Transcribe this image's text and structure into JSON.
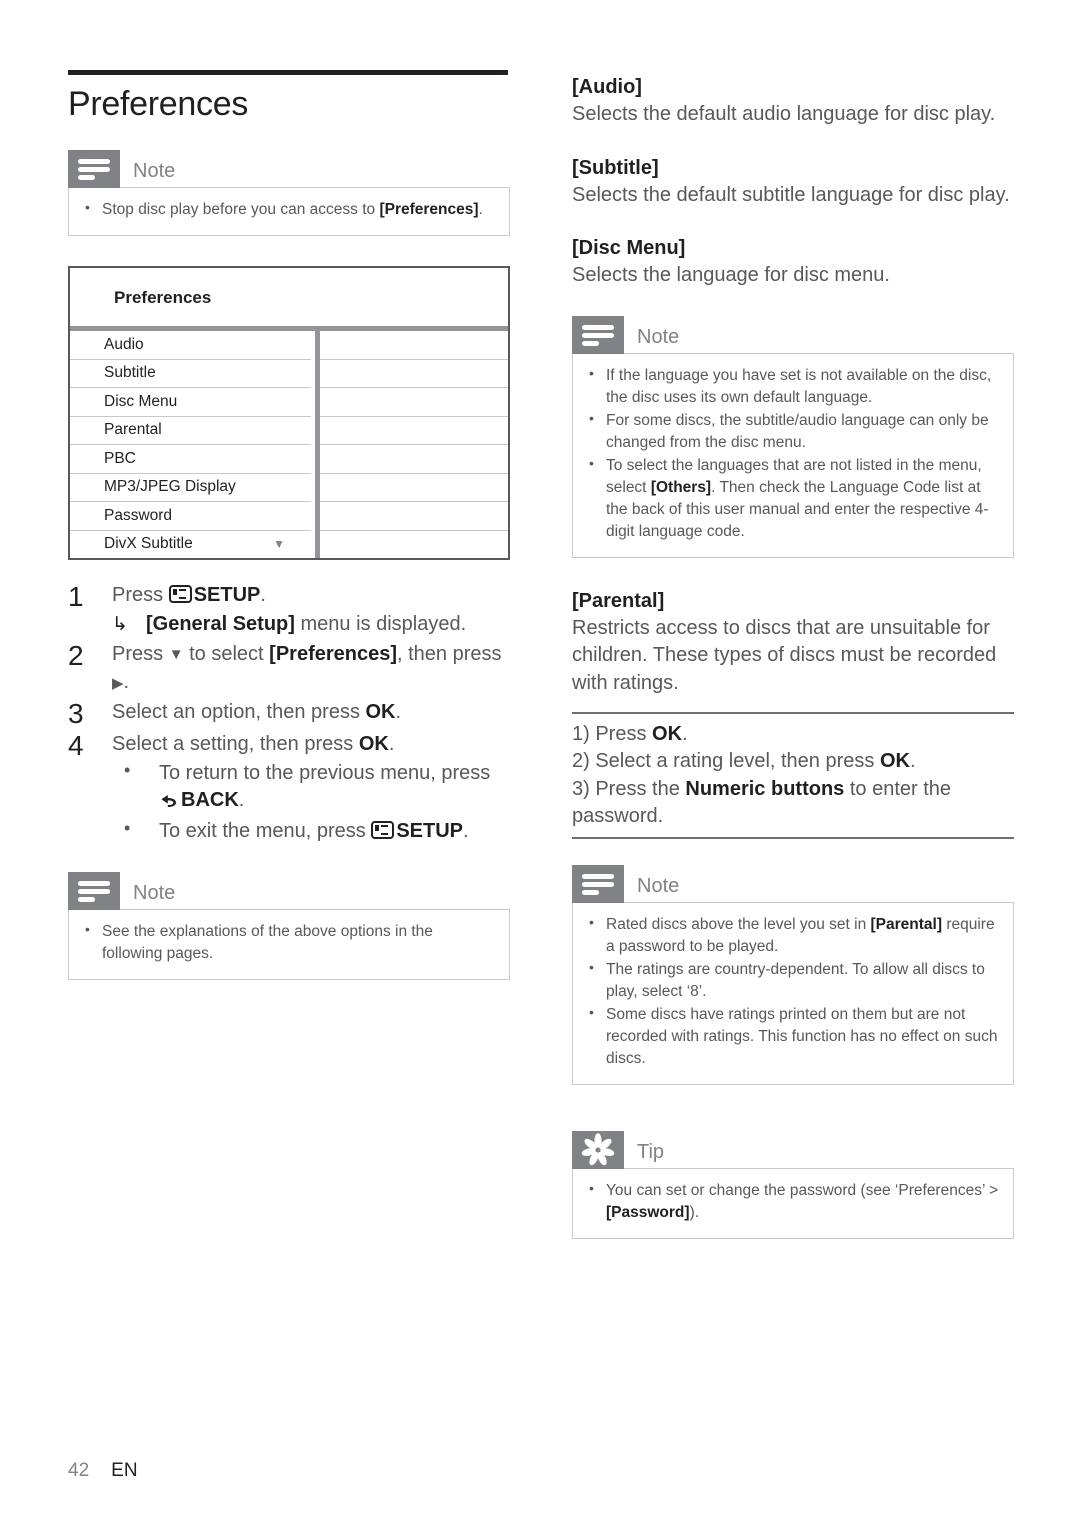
{
  "page": {
    "title": "Preferences",
    "footer_page_number": "42",
    "footer_language": "EN"
  },
  "left_column": {
    "note_top": {
      "label": "Note",
      "icon": "note-lines-icon",
      "items": [
        {
          "text_before": "Stop disc play before you can access to ",
          "bold": "[Preferences]",
          "text_after": "."
        }
      ]
    },
    "menu_screenshot": {
      "title": "Preferences",
      "rows": [
        {
          "label": "Audio",
          "value": ""
        },
        {
          "label": "Subtitle",
          "value": ""
        },
        {
          "label": "Disc Menu",
          "value": ""
        },
        {
          "label": "Parental",
          "value": ""
        },
        {
          "label": "PBC",
          "value": ""
        },
        {
          "label": "MP3/JPEG Display",
          "value": ""
        },
        {
          "label": "Password",
          "value": ""
        },
        {
          "label": "DivX Subtitle",
          "value": "",
          "caret": "▼"
        }
      ]
    },
    "steps": [
      {
        "number": "1",
        "text_before": "Press ",
        "icon": "setup-icon",
        "bold": "SETUP",
        "text_after": ".",
        "sub_arrow": {
          "glyph": "↳",
          "bold": "[General Setup]",
          "text_after": " menu is displayed."
        }
      },
      {
        "number": "2",
        "text_before": "Press ",
        "glyph": "▼",
        "text_mid": " to select ",
        "bold": "[Preferences]",
        "text_after": ", then press ",
        "glyph2": "▶",
        "text_end": "."
      },
      {
        "number": "3",
        "text_before": "Select an option, then press ",
        "bold": "OK",
        "text_after": "."
      },
      {
        "number": "4",
        "text_before": "Select a setting, then press ",
        "bold": "OK",
        "text_after": ".",
        "bullets": [
          {
            "text_before": "To return to the previous menu, press ",
            "icon": "back-icon",
            "bold": "BACK",
            "text_after": "."
          },
          {
            "text_before": "To exit the menu, press ",
            "icon": "setup-icon",
            "bold": "SETUP",
            "text_after": "."
          }
        ]
      }
    ],
    "note_bottom": {
      "label": "Note",
      "icon": "note-lines-icon",
      "items": [
        {
          "text_before": "See the explanations of the above options in the following pages.",
          "bold": "",
          "text_after": ""
        }
      ]
    }
  },
  "right_column": {
    "options": [
      {
        "title": "[Audio]",
        "text": "Selects the default audio language for disc play."
      },
      {
        "title": "[Subtitle]",
        "text": "Selects the default subtitle language for disc play."
      },
      {
        "title": "[Disc Menu]",
        "text": "Selects the language for disc menu."
      }
    ],
    "note_language": {
      "label": "Note",
      "icon": "note-lines-icon",
      "items": [
        {
          "text_before": "If the language you have set is not available on the disc, the disc uses its own default language.",
          "bold": "",
          "text_after": ""
        },
        {
          "text_before": "For some discs, the subtitle/audio language can only be changed from the disc menu.",
          "bold": "",
          "text_after": ""
        },
        {
          "text_before": "To select the languages that are not listed in the menu, select ",
          "bold": "[Others]",
          "text_after": ". Then check the Language Code list at the back of this user manual and enter the respective 4-digit language code."
        }
      ]
    },
    "parental": {
      "title": "[Parental]",
      "text": "Restricts access to discs that are unsuitable for children. These types of discs must be recorded with ratings.",
      "procedure": [
        {
          "text_before": "1) Press ",
          "bold": "OK",
          "text_after": "."
        },
        {
          "text_before": "2) Select a rating level, then press ",
          "bold": "OK",
          "text_after": "."
        },
        {
          "text_before": "3) Press the ",
          "bold": "Numeric buttons",
          "text_after": " to enter the password."
        }
      ]
    },
    "note_parental": {
      "label": "Note",
      "icon": "note-lines-icon",
      "items": [
        {
          "text_before": "Rated discs above the level you set in ",
          "bold": "[Parental]",
          "text_after": " require a password to be played."
        },
        {
          "text_before": "The ratings are country-dependent. To allow all discs to play, select ‘8’.",
          "bold": "",
          "text_after": ""
        },
        {
          "text_before": "Some discs have ratings printed on them but are not recorded with ratings. This function has no effect on such discs.",
          "bold": "",
          "text_after": ""
        }
      ]
    },
    "tip": {
      "label": "Tip",
      "icon": "tip-star-icon",
      "items": [
        {
          "text_before": "You can set or change the password (see ‘Preferences’ > ",
          "bold": "[Password]",
          "text_after": ")."
        }
      ]
    }
  },
  "colors": {
    "icon_badge": "#808285",
    "rule_dark": "#231f20",
    "menu_border": "#58595b",
    "menu_divider": "#939598",
    "body_text": "#58585b"
  }
}
